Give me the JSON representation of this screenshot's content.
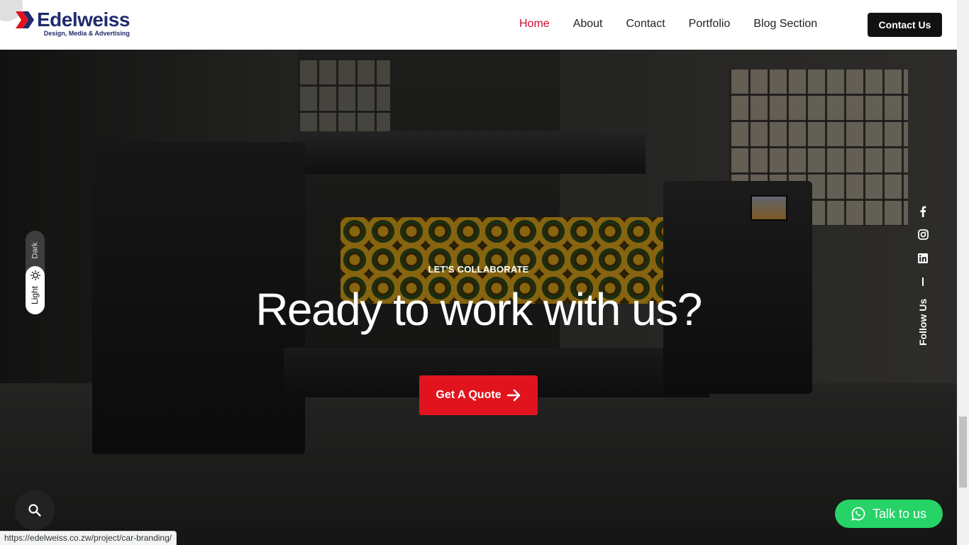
{
  "header": {
    "logo_name": "Edelweiss",
    "logo_tagline": "Design, Media & Advertising",
    "nav": [
      {
        "label": "Home",
        "active": true
      },
      {
        "label": "About",
        "active": false
      },
      {
        "label": "Contact",
        "active": false
      },
      {
        "label": "Portfolio",
        "active": false
      },
      {
        "label": "Blog Section",
        "active": false
      }
    ],
    "cta_label": "Contact Us"
  },
  "hero": {
    "eyebrow": "LET'S COLLABORATE",
    "title": "Ready to work with us?",
    "button_label": "Get A Quote",
    "button_icon": "arrow-right-icon"
  },
  "theme_toggle": {
    "dark_label": "Dark",
    "light_label": "Light",
    "selected": "Light",
    "icon": "sun-icon"
  },
  "follow": {
    "label": "Follow Us",
    "socials": [
      "facebook-icon",
      "instagram-icon",
      "linkedin-icon"
    ]
  },
  "floating": {
    "search_icon": "search-icon",
    "whatsapp_label": "Talk to us",
    "whatsapp_icon": "whatsapp-icon"
  },
  "status_bar": {
    "url": "https://edelweiss.co.zw/project/car-branding/"
  },
  "colors": {
    "brand_navy": "#1f2b6b",
    "accent_red": "#e1141e",
    "nav_active": "#c8102e",
    "whatsapp_green": "#25d366"
  }
}
